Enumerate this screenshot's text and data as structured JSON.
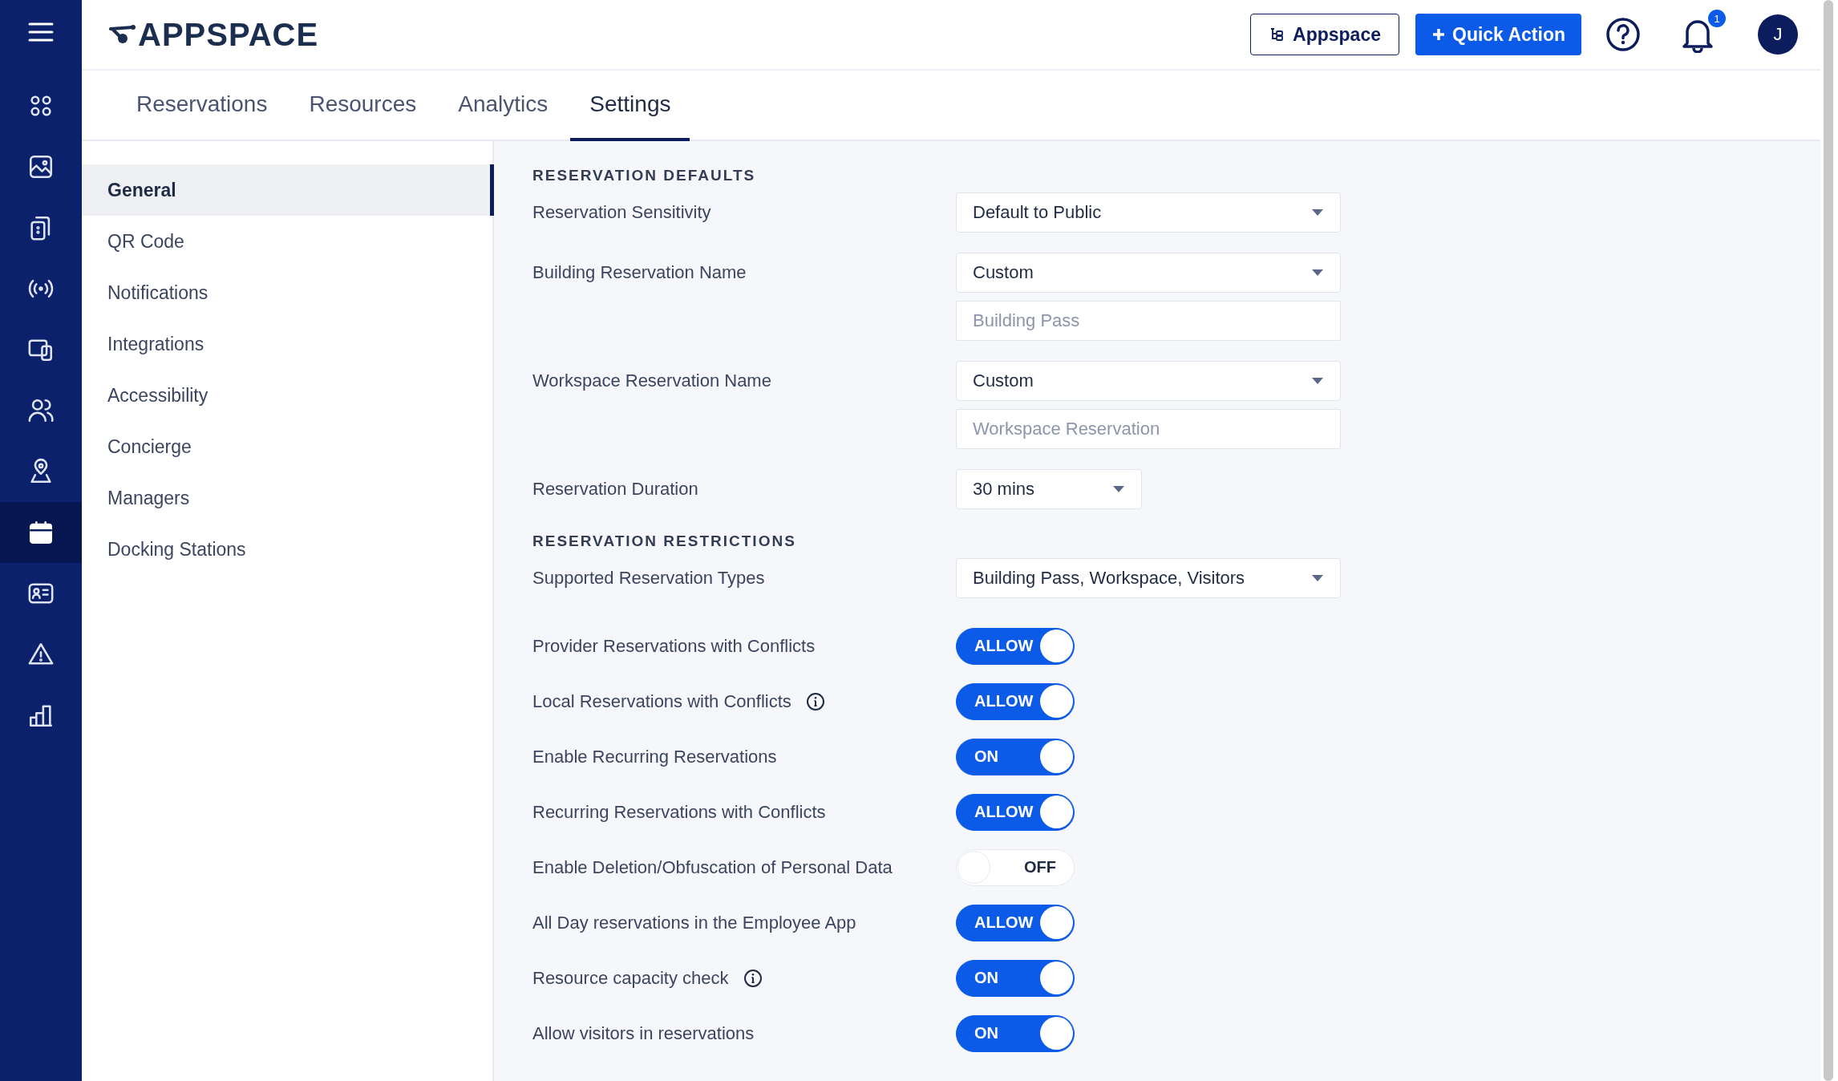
{
  "header": {
    "logo_text": "APPSPACE",
    "appspace_button": "Appspace",
    "quick_action_button": "Quick Action",
    "notification_count": "1",
    "avatar_initial": "J"
  },
  "sidebar": {
    "items": [
      {
        "selected": false
      },
      {
        "selected": false
      },
      {
        "selected": false
      },
      {
        "selected": false
      },
      {
        "selected": false
      },
      {
        "selected": false
      },
      {
        "selected": false
      },
      {
        "selected": true
      },
      {
        "selected": false
      },
      {
        "selected": false
      },
      {
        "selected": false
      }
    ]
  },
  "tabs": [
    {
      "label": "Reservations",
      "selected": false
    },
    {
      "label": "Resources",
      "selected": false
    },
    {
      "label": "Analytics",
      "selected": false
    },
    {
      "label": "Settings",
      "selected": true
    }
  ],
  "settings_nav": [
    {
      "label": "General",
      "selected": true
    },
    {
      "label": "QR Code",
      "selected": false
    },
    {
      "label": "Notifications",
      "selected": false
    },
    {
      "label": "Integrations",
      "selected": false
    },
    {
      "label": "Accessibility",
      "selected": false
    },
    {
      "label": "Concierge",
      "selected": false
    },
    {
      "label": "Managers",
      "selected": false
    },
    {
      "label": "Docking Stations",
      "selected": false
    }
  ],
  "sections": [
    {
      "title": "RESERVATION DEFAULTS",
      "rows": [
        {
          "kind": "select",
          "label": "Reservation Sensitivity",
          "value": "Default to Public"
        },
        {
          "kind": "select",
          "label": "Building Reservation Name",
          "value": "Custom",
          "placeholder": "Building Pass"
        },
        {
          "kind": "select",
          "label": "Workspace Reservation Name",
          "value": "Custom",
          "placeholder": "Workspace Reservation"
        },
        {
          "kind": "short_select",
          "label": "Reservation Duration",
          "value": "30 mins"
        }
      ]
    },
    {
      "title": "RESERVATION RESTRICTIONS",
      "rows": [
        {
          "kind": "select",
          "label": "Supported Reservation Types",
          "value": "Building Pass, Workspace, Visitors"
        },
        {
          "kind": "toggle",
          "label": "Provider Reservations with Conflicts",
          "on": true,
          "text": "ALLOW",
          "info": false
        },
        {
          "kind": "toggle",
          "label": "Local Reservations with Conflicts",
          "on": true,
          "text": "ALLOW",
          "info": true
        },
        {
          "kind": "toggle",
          "label": "Enable Recurring Reservations",
          "on": true,
          "text": "ON",
          "info": false
        },
        {
          "kind": "toggle",
          "label": "Recurring Reservations with Conflicts",
          "on": true,
          "text": "ALLOW",
          "info": false
        },
        {
          "kind": "toggle",
          "label": "Enable Deletion/Obfuscation of Personal Data",
          "on": false,
          "text": "OFF",
          "info": false
        },
        {
          "kind": "toggle",
          "label": "All Day reservations in the Employee App",
          "on": true,
          "text": "ALLOW",
          "info": false
        },
        {
          "kind": "toggle",
          "label": "Resource capacity check",
          "on": true,
          "text": "ON",
          "info": true
        },
        {
          "kind": "toggle",
          "label": "Allow visitors in reservations",
          "on": true,
          "text": "ON",
          "info": false
        }
      ]
    }
  ]
}
